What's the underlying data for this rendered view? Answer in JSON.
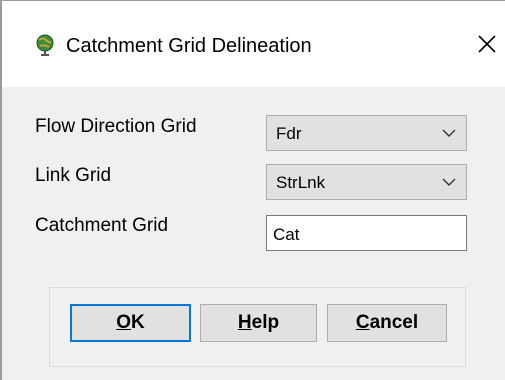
{
  "window": {
    "title": "Catchment Grid Delineation",
    "close_glyph": "✕",
    "icon": "globe-pin-icon"
  },
  "fields": {
    "flow_direction": {
      "label": "Flow Direction Grid",
      "value": "Fdr"
    },
    "link_grid": {
      "label": "Link Grid",
      "value": "StrLnk"
    },
    "catchment_grid": {
      "label": "Catchment Grid",
      "value": "Cat"
    }
  },
  "buttons": {
    "ok": {
      "mnemonic": "O",
      "rest": "K"
    },
    "help": {
      "mnemonic": "H",
      "rest": "elp"
    },
    "cancel": {
      "mnemonic": "C",
      "rest": "ancel"
    }
  },
  "colors": {
    "dialog_bg": "#f0f0f0",
    "titlebar_bg": "#ffffff",
    "focus_border": "#0078d7"
  }
}
